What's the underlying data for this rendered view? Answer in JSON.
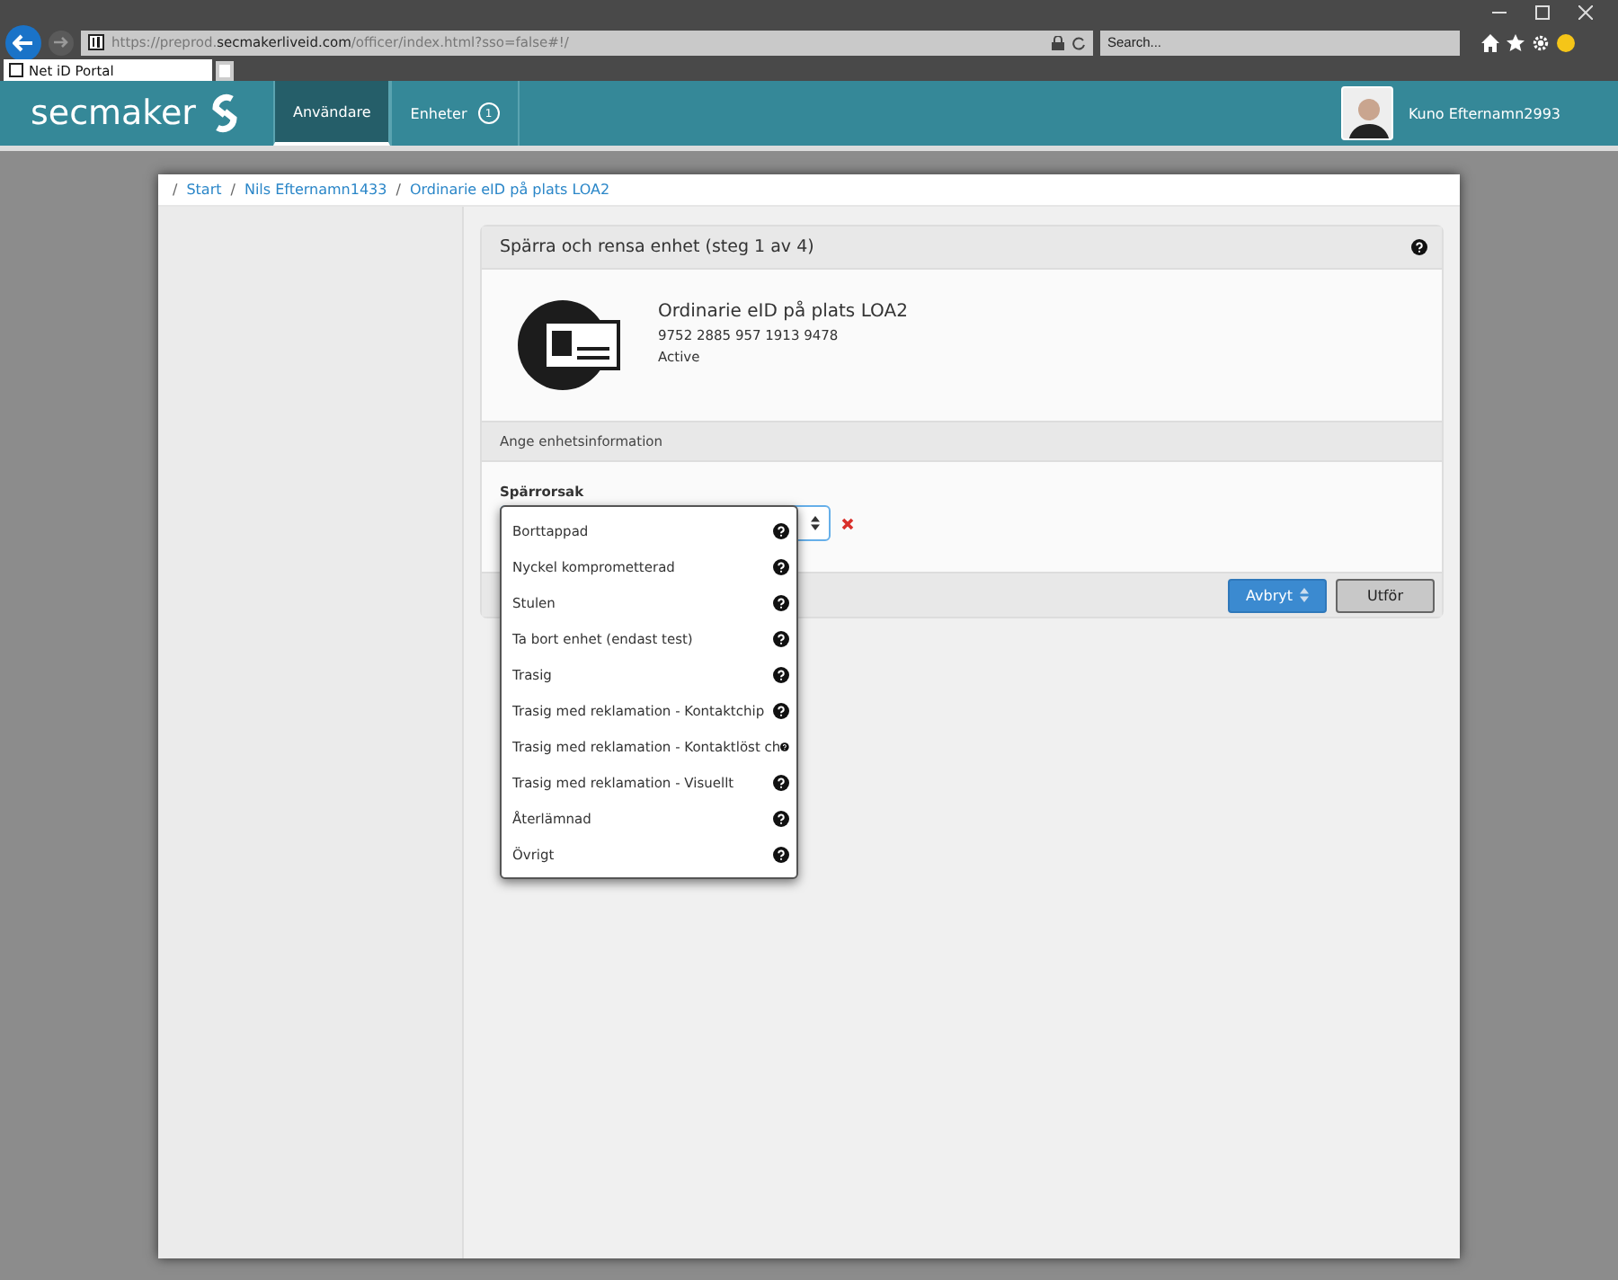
{
  "browser": {
    "url": "https://preprod.**secmakerliveid.com**/officer/index.html?sso=false#!/",
    "search": {
      "placeholder": "Search..."
    },
    "tabs": [
      {
        "label": "Net iD Portal",
        "selected": true
      }
    ]
  },
  "header": {
    "logo": "secmaker",
    "nav": [
      {
        "label": "Användare",
        "selected": true
      },
      {
        "label": "Enheter",
        "badge": "1",
        "selected": false
      }
    ],
    "user": "Kuno Efternamn2993"
  },
  "breadcrumb": {
    "separator": "/",
    "items": [
      "Start",
      "Nils Efternamn1433",
      "Ordinarie eID på plats LOA2"
    ]
  },
  "panel": {
    "title": "Spärra och rensa enhet (steg 1 av 4)",
    "device": {
      "name": "Ordinarie eID på plats LOA2",
      "number": "9752 2885 957 1913 9478",
      "status": "Active"
    },
    "section": "Ange enhetsinformation",
    "field_label": "Spärrorsak",
    "options": [
      {
        "label": "Borttappad"
      },
      {
        "label": "Nyckel komprometterad"
      },
      {
        "label": "Stulen"
      },
      {
        "label": "Ta bort enhet (endast test)"
      },
      {
        "label": "Trasig"
      },
      {
        "label": "Trasig med reklamation - Kontaktchip"
      },
      {
        "label": "Trasig med reklamation - Kontaktlöst ch"
      },
      {
        "label": "Trasig med reklamation - Visuellt"
      },
      {
        "label": "Återlämnad"
      },
      {
        "label": "Övrigt"
      }
    ],
    "buttons": [
      {
        "label": "Avbryt",
        "kind": "primary"
      },
      {
        "label": "Utför",
        "kind": "default"
      }
    ]
  }
}
